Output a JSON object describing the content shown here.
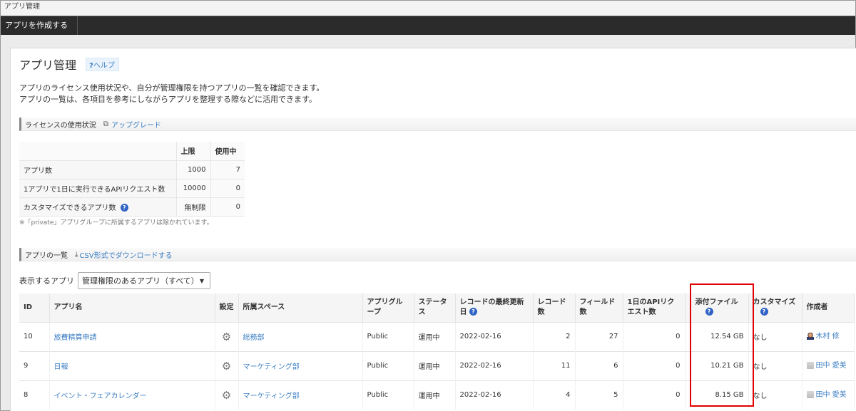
{
  "window": {
    "title": "アプリ管理"
  },
  "toolbar": {
    "create_label": "アプリを作成する"
  },
  "page": {
    "title": "アプリ管理",
    "help_icon": "?",
    "help_label": "ヘルプ",
    "desc_line1": "アプリのライセンス使用状況や、自分が管理権限を持つアプリの一覧を確認できます。",
    "desc_line2": "アプリの一覧は、各項目を参考にしながらアプリを整理する際などに活用できます。"
  },
  "license": {
    "section_title": "ライセンスの使用状況",
    "upgrade_icon": "external-window-icon",
    "upgrade_label": "アップグレード",
    "col_limit": "上限",
    "col_used": "使用中",
    "rows": [
      {
        "label": "アプリ数",
        "limit": "1000",
        "used": "7"
      },
      {
        "label": "1アプリで1日に実行できるAPIリクエスト数",
        "limit": "10000",
        "used": "0"
      },
      {
        "label": "カスタマイズできるアプリ数",
        "limit": "無制限",
        "used": "0"
      }
    ],
    "note": "※「private」アプリグループに所属するアプリは除かれています。"
  },
  "apps": {
    "section_title": "アプリの一覧",
    "download_icon": "download-icon",
    "download_label": "CSV形式でダウンロードする",
    "filter_label": "表示するアプリ",
    "filter_value": "管理権限のあるアプリ（すべて）",
    "columns": {
      "id": "ID",
      "name": "アプリ名",
      "settings": "設定",
      "space": "所属スペース",
      "group": "アプリグループ",
      "status": "ステータス",
      "last_updated": "レコードの最終更新日",
      "records": "レコード数",
      "fields": "フィールド数",
      "api": "1日のAPIリクエスト数",
      "attachments": "添付ファイル",
      "customize": "カスタマイズ",
      "creator": "作成者"
    },
    "rows": [
      {
        "id": "10",
        "name": "旅費精算申請",
        "space": "総務部",
        "group": "Public",
        "status": "運用中",
        "updated": "2022-02-16",
        "records": "2",
        "fields": "27",
        "api": "0",
        "attachments": "12.54 GB",
        "customize": "なし",
        "creator": "木村 修"
      },
      {
        "id": "9",
        "name": "日報",
        "space": "マーケティング部",
        "group": "Public",
        "status": "運用中",
        "updated": "2022-02-16",
        "records": "11",
        "fields": "6",
        "api": "0",
        "attachments": "10.21 GB",
        "customize": "なし",
        "creator": "田中 愛美"
      },
      {
        "id": "8",
        "name": "イベント・フェアカレンダー",
        "space": "マーケティング部",
        "group": "Public",
        "status": "運用中",
        "updated": "2022-02-16",
        "records": "4",
        "fields": "5",
        "api": "0",
        "attachments": "8.15 GB",
        "customize": "なし",
        "creator": "田中 愛美"
      }
    ]
  },
  "colors": {
    "accent": "#3c7fc4",
    "highlight": "#e00000",
    "toolbar": "#2b2b2b"
  }
}
